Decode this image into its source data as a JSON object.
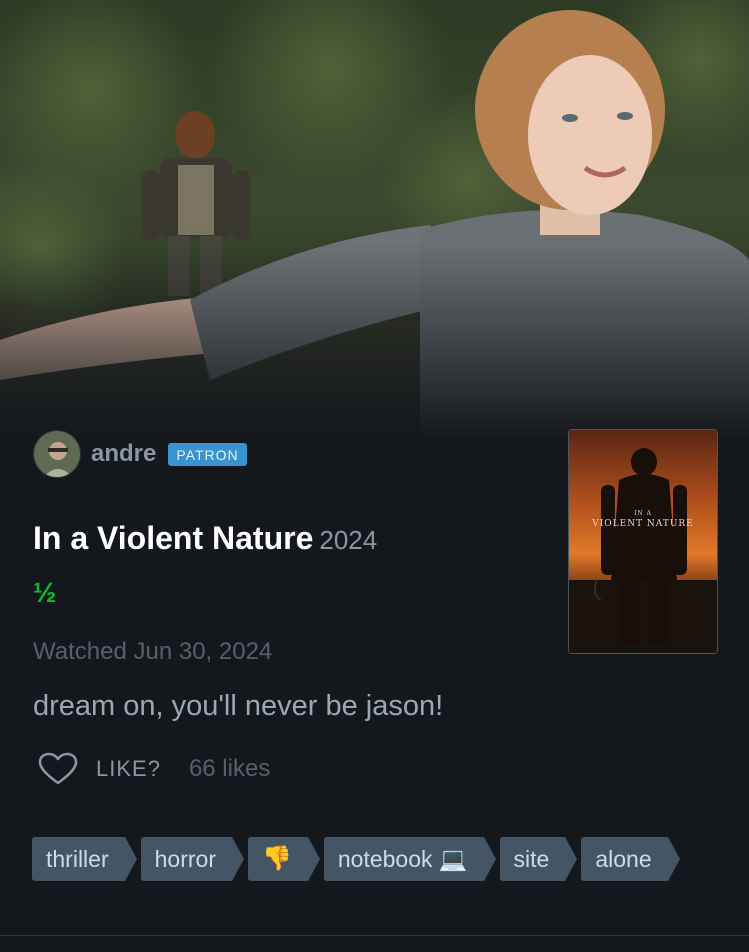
{
  "author": {
    "name": "andre",
    "badge": "PATRON"
  },
  "film": {
    "title": "In a Violent Nature",
    "year": "2024",
    "rating": "½",
    "poster_text_small": "IN A",
    "poster_text_big": "VIOLENT NATURE"
  },
  "review": {
    "watched": "Watched Jun 30, 2024",
    "text": "dream on, you'll never be jason!"
  },
  "likes": {
    "button_label": "LIKE?",
    "count_text": "66 likes"
  },
  "tags": [
    "thriller",
    "horror",
    "👎",
    "notebook 💻",
    "site",
    "alone"
  ],
  "colors": {
    "background": "#14181c",
    "rating_green": "#00c030",
    "patron_blue": "#3a93d1",
    "tag_bg": "#445566"
  }
}
